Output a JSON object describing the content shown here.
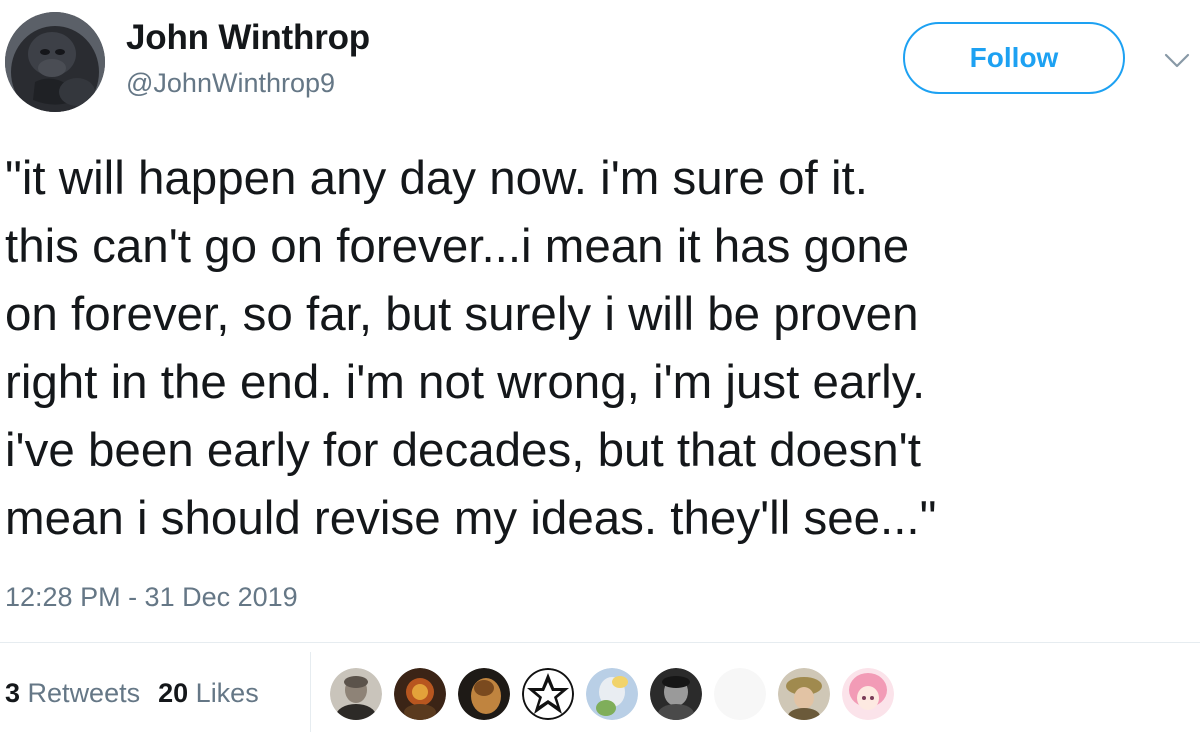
{
  "tweet": {
    "display_name": "John Winthrop",
    "handle": "@JohnWinthrop9",
    "follow_label": "Follow",
    "text": "\"it will happen any day now. i'm sure of it.\nthis can't go on forever...i mean it has gone\non forever, so far, but surely i will be proven\nright in the end. i'm not wrong, i'm just early.\ni've been early for decades, but that doesn't\nmean i should revise my ideas. they'll see...\"",
    "timestamp": "12:28 PM - 31 Dec 2019",
    "retweets_count": "3",
    "retweets_label": "Retweets",
    "likes_count": "20",
    "likes_label": "Likes"
  },
  "colors": {
    "accent": "#1da1f2",
    "text": "#14171a",
    "secondary": "#657786",
    "divider": "#e6ecf0"
  },
  "icons": {
    "avatar": "gorilla-avatar",
    "caret": "chevron-down-icon"
  },
  "likers": [
    {
      "name": "liker-avatar-1"
    },
    {
      "name": "liker-avatar-2"
    },
    {
      "name": "liker-avatar-3"
    },
    {
      "name": "liker-avatar-4"
    },
    {
      "name": "liker-avatar-5"
    },
    {
      "name": "liker-avatar-6"
    },
    {
      "name": "liker-avatar-7"
    },
    {
      "name": "liker-avatar-8"
    },
    {
      "name": "liker-avatar-9"
    }
  ]
}
